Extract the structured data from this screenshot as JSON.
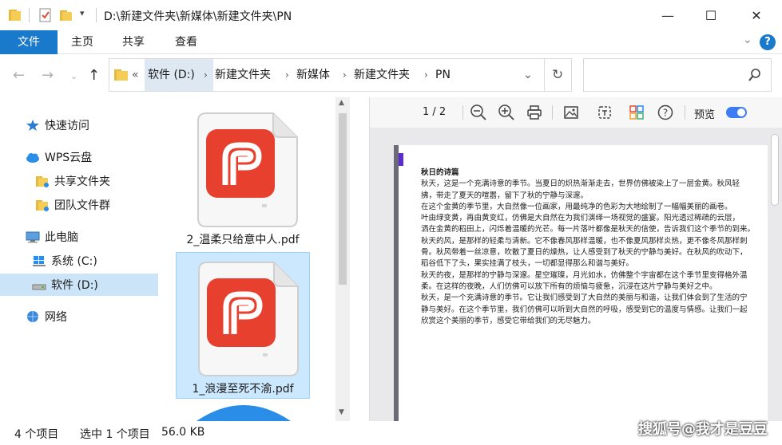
{
  "window": {
    "title": "D:\\新建文件夹\\新媒体\\新建文件夹\\PN",
    "minimize": "—",
    "maximize": "☐",
    "close": "✕"
  },
  "ribbon": {
    "tabs": [
      "文件",
      "主页",
      "共享",
      "查看"
    ],
    "expand": "⌄",
    "help": "?"
  },
  "address": {
    "prefix": "«",
    "segments": [
      "软件 (D:)",
      "新建文件夹",
      "新媒体",
      "新建文件夹",
      "PN"
    ],
    "separator": "›",
    "dropdown": "⌄",
    "refresh": "↻"
  },
  "search": {
    "placeholder": "",
    "icon": "search-icon"
  },
  "nav": {
    "items": [
      {
        "label": "快速访问",
        "icon": "star-icon"
      },
      {
        "label": "WPS云盘",
        "icon": "cloud-icon"
      },
      {
        "label": "共享文件夹",
        "icon": "folder-icon"
      },
      {
        "label": "团队文件群",
        "icon": "folder-icon"
      },
      {
        "label": "此电脑",
        "icon": "computer-icon"
      },
      {
        "label": "系统 (C:)",
        "icon": "windows-drive-icon"
      },
      {
        "label": "软件 (D:)",
        "icon": "drive-icon"
      },
      {
        "label": "网络",
        "icon": "network-icon"
      }
    ]
  },
  "files": [
    {
      "name": "2_温柔只给意中人.pdf",
      "selected": false
    },
    {
      "name": "1_浪漫至死不渝.pdf",
      "selected": true
    }
  ],
  "preview": {
    "page_indicator": "1 / 2",
    "preview_label": "预览",
    "preview_on": true,
    "doc_title": "秋日的诗篇",
    "doc_lines": [
      "秋天，这是一个充满诗意的季节。当夏日的炽热渐渐走去，世界仿佛被染上了一层金黄。秋风轻",
      "拂，带走了夏天的喧嚣，留下了秋的宁静与深邃。",
      "在这个金黄的季节里，大自然像一位画家，用最纯净的色彩为大地绘制了一幅幅美丽的画卷。",
      "叶由绿变黄，再由黄变红，仿佛是大自然在为我们演绎一场视觉的盛宴。阳光透过稀疏的云层，",
      "洒在金黄的稻田上，闪烁着温暖的光芒。每一片落叶都像是秋天的信使，告诉我们这个季节的到来。",
      "秋天的风，是那样的轻柔与清新。它不像春风那样温暖，也不像夏风那样炎热，更不像冬风那样刺",
      "骨。秋风带着一丝凉意，吹散了夏日的燥热，让人感受到了秋天的宁静与美好。在秋风的吹动下，",
      "稻谷低下了头，果实挂满了枝头，一切都显得那么和谐与美好。",
      "秋天的夜，是那样的宁静与深邃。星空璀璨，月光如水，仿佛整个宇宙都在这个季节里变得格外温",
      "柔。在这样的夜晚，人们仿佛可以放下所有的烦恼与疲惫，沉浸在这片宁静与美好之中。",
      "秋天，是一个充满诗意的季节。它让我们感受到了大自然的美丽与和谐，让我们体会到了生活的宁",
      "静与美好。在这个季节里，我们仿佛可以听到大自然的呼吸，感受到它的温度与情感。让我们一起",
      "欣赏这个美丽的季节，感受它带给我们的无尽魅力。"
    ]
  },
  "status": {
    "count": "4 个项目",
    "selection": "选中 1 个项目",
    "size": "56.0 KB"
  },
  "watermark": "搜狐号@我才是豆豆",
  "colors": {
    "accent": "#1979ca",
    "selection": "#cce8ff",
    "pdf_red": "#e8402f",
    "toggle": "#3d7cf4"
  }
}
